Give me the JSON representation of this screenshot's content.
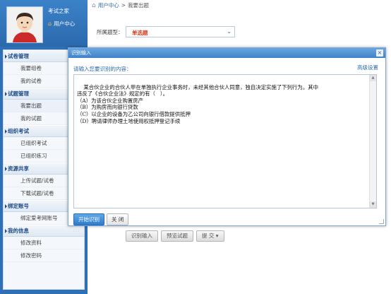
{
  "profile": {
    "site_name": "考试之家",
    "user_center": "用户中心"
  },
  "sidebar": {
    "groups": [
      {
        "title": "试卷管理",
        "items": [
          "我要组卷",
          "我的试卷"
        ]
      },
      {
        "title": "试题管理",
        "items": [
          "我要出题",
          "我的试题"
        ]
      },
      {
        "title": "组织考试",
        "items": [
          "已组织考试",
          "已组织练习"
        ]
      },
      {
        "title": "资源共享",
        "items": [
          "上传试题/试卷",
          "下载试题/试卷"
        ]
      },
      {
        "title": "绑定账号",
        "items": [
          "绑定爱考网账号"
        ]
      },
      {
        "title": "我的信息",
        "items": [
          "修改资料",
          "修改密码"
        ]
      }
    ],
    "active_item": "我要出题"
  },
  "breadcrumb": {
    "home": "用户中心",
    "separator": ">",
    "current": "我要出题"
  },
  "form": {
    "type_label": "所属题型：",
    "type_value": "单选题"
  },
  "bottom_buttons": {
    "recognize_input": "识别输入",
    "preview": "预览试题",
    "submit": "提 交"
  },
  "dialog": {
    "title": "识别输入",
    "close": "×",
    "prompt": "请输入您要识别的内容：",
    "advanced": "高级设置",
    "content": "某合伙企业的合伙人甲在单独执行企业事务时，未经其他合伙人同意，独自决定实施了下列行为。其中\n违反了《合伙企业法》规定的有（   ）。\n（A）为该合伙企业购置房产\n（B）为购房而向银行贷款\n（C）以企业的设备为乙公司向银行借款提供抵押\n（D）聘请律师办理土地使用权抵押登记手续",
    "start_button": "开始识别",
    "close_button": "关 闭"
  },
  "colors": {
    "sidebar_bg": "#2f6fb3",
    "accent": "#2c69ad",
    "select_value": "#d23a1c"
  }
}
